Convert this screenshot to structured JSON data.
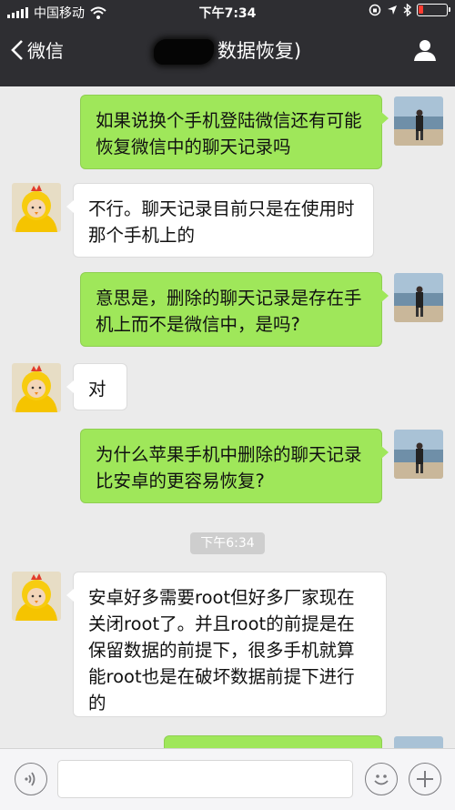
{
  "status_bar": {
    "carrier": "中国移动",
    "time": "下午7:34",
    "battery_color": "#ff3b30"
  },
  "nav": {
    "back_label": "微信",
    "title_suffix": "数据恢复)"
  },
  "messages": [
    {
      "side": "me",
      "text": "如果说换个手机登陆微信还有可能恢复微信中的聊天记录吗"
    },
    {
      "side": "them",
      "text": "不行。聊天记录目前只是在使用时那个手机上的"
    },
    {
      "side": "me",
      "text": "意思是，删除的聊天记录是存在手机上而不是微信中，是吗?"
    },
    {
      "side": "them",
      "text": "对"
    },
    {
      "side": "me",
      "text": "为什么苹果手机中删除的聊天记录比安卓的更容易恢复?"
    },
    {
      "side": "them",
      "text": "安卓好多需要root但好多厂家现在关闭root了。并且root的前提是在保留数据的前提下，很多手机就算能root也是在破坏数据前提下进行的"
    }
  ],
  "timestamp": "下午6:34",
  "input": {
    "value": "",
    "placeholder": ""
  },
  "colors": {
    "me_bubble": "#9fe75a",
    "them_bubble": "#ffffff",
    "topbar": "#2e2e32"
  }
}
